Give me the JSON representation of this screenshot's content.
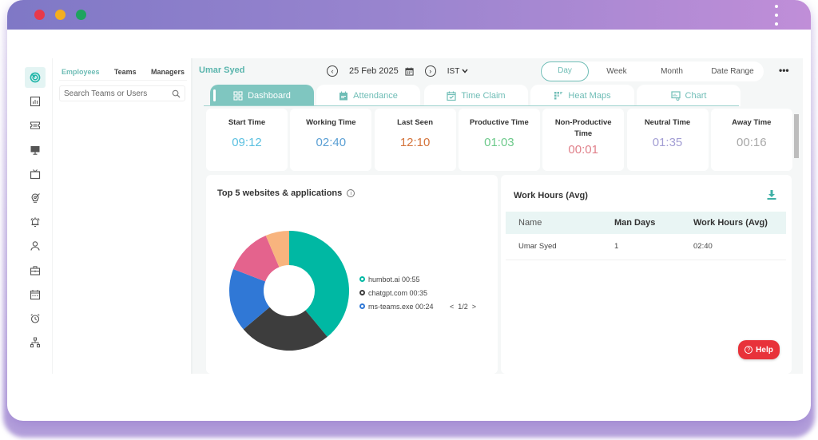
{
  "window": {
    "traffic_lights": [
      {
        "name": "close",
        "color": "#e8394a"
      },
      {
        "name": "minimize",
        "color": "#f3ae1f"
      },
      {
        "name": "maximize",
        "color": "#1fa35f"
      }
    ]
  },
  "iconbar": {
    "items": [
      {
        "icon": "radar-icon",
        "active": true
      },
      {
        "icon": "report-chart-icon",
        "active": false
      },
      {
        "icon": "ticket-icon",
        "active": false
      },
      {
        "icon": "monitor-icon",
        "active": false
      },
      {
        "icon": "tv-icon",
        "active": false
      },
      {
        "icon": "lightbulb-target-icon",
        "active": false
      },
      {
        "icon": "alarm-bell-icon",
        "active": false
      },
      {
        "icon": "user-icon",
        "active": false
      },
      {
        "icon": "briefcase-icon",
        "active": false
      },
      {
        "icon": "calendar-icon",
        "active": false
      },
      {
        "icon": "alarm-clock-icon",
        "active": false
      },
      {
        "icon": "org-chart-icon",
        "active": false
      }
    ]
  },
  "left_panel": {
    "tabs": [
      {
        "label": "Employees",
        "active": true
      },
      {
        "label": "Teams",
        "active": false
      },
      {
        "label": "Managers",
        "active": false
      }
    ],
    "search_placeholder": "Search Teams or Users",
    "search_value": ""
  },
  "header": {
    "user_name": "Umar Syed",
    "prev_label": "‹",
    "date": "25 Feb 2025",
    "next_label": "›",
    "timezone": "IST",
    "range_options": [
      {
        "label": "Day",
        "active": true
      },
      {
        "label": "Week",
        "active": false
      },
      {
        "label": "Month",
        "active": false
      },
      {
        "label": "Date Range",
        "active": false
      }
    ],
    "more_label": "•••"
  },
  "tabs": [
    {
      "label": "Dashboard",
      "icon": "dashboard-grid-icon",
      "active": true
    },
    {
      "label": "Attendance",
      "icon": "calendar-list-icon",
      "active": false
    },
    {
      "label": "Time Claim",
      "icon": "calendar-check-icon",
      "active": false
    },
    {
      "label": "Heat Maps",
      "icon": "heatmap-icon",
      "active": false
    },
    {
      "label": "Chart",
      "icon": "chart-screen-icon",
      "active": false
    }
  ],
  "stats": [
    {
      "label": "Start Time",
      "value": "09:12",
      "color": "#5bc0e0"
    },
    {
      "label": "Working Time",
      "value": "02:40",
      "color": "#5a9fd4"
    },
    {
      "label": "Last Seen",
      "value": "12:10",
      "color": "#d4733a"
    },
    {
      "label": "Productive Time",
      "value": "01:03",
      "color": "#6cc98a"
    },
    {
      "label": "Non-Productive Time",
      "value": "00:01",
      "color": "#e0808a"
    },
    {
      "label": "Neutral Time",
      "value": "01:35",
      "color": "#a39ed4"
    },
    {
      "label": "Away Time",
      "value": "00:16",
      "color": "#a8a8a8"
    }
  ],
  "top_apps": {
    "title": "Top 5 websites & applications",
    "pager": {
      "prev": "<",
      "label": "1/2",
      "next": ">"
    }
  },
  "chart_data": {
    "type": "pie",
    "title": "Top 5 websites & applications",
    "donut": true,
    "legend_position": "right",
    "slices": [
      {
        "label": "humbot.ai",
        "time": "00:55",
        "minutes": 55,
        "color": "#00b8a3",
        "in_legend": true
      },
      {
        "label": "chatgpt.com",
        "time": "00:35",
        "minutes": 35,
        "color": "#3d3d3d",
        "in_legend": true
      },
      {
        "label": "ms-teams.exe",
        "time": "00:24",
        "minutes": 24,
        "color": "#3078d6",
        "in_legend": true
      },
      {
        "label": "",
        "time": "",
        "minutes": 18,
        "color": "#e4638d",
        "in_legend": false
      },
      {
        "label": "",
        "time": "",
        "minutes": 9,
        "color": "#f8b47e",
        "in_legend": false
      }
    ]
  },
  "work_hours": {
    "title": "Work Hours (Avg)",
    "columns": [
      "Name",
      "Man Days",
      "Work Hours (Avg)"
    ],
    "rows": [
      [
        "Umar Syed",
        "1",
        "02:40"
      ]
    ]
  },
  "help": {
    "label": "Help"
  }
}
